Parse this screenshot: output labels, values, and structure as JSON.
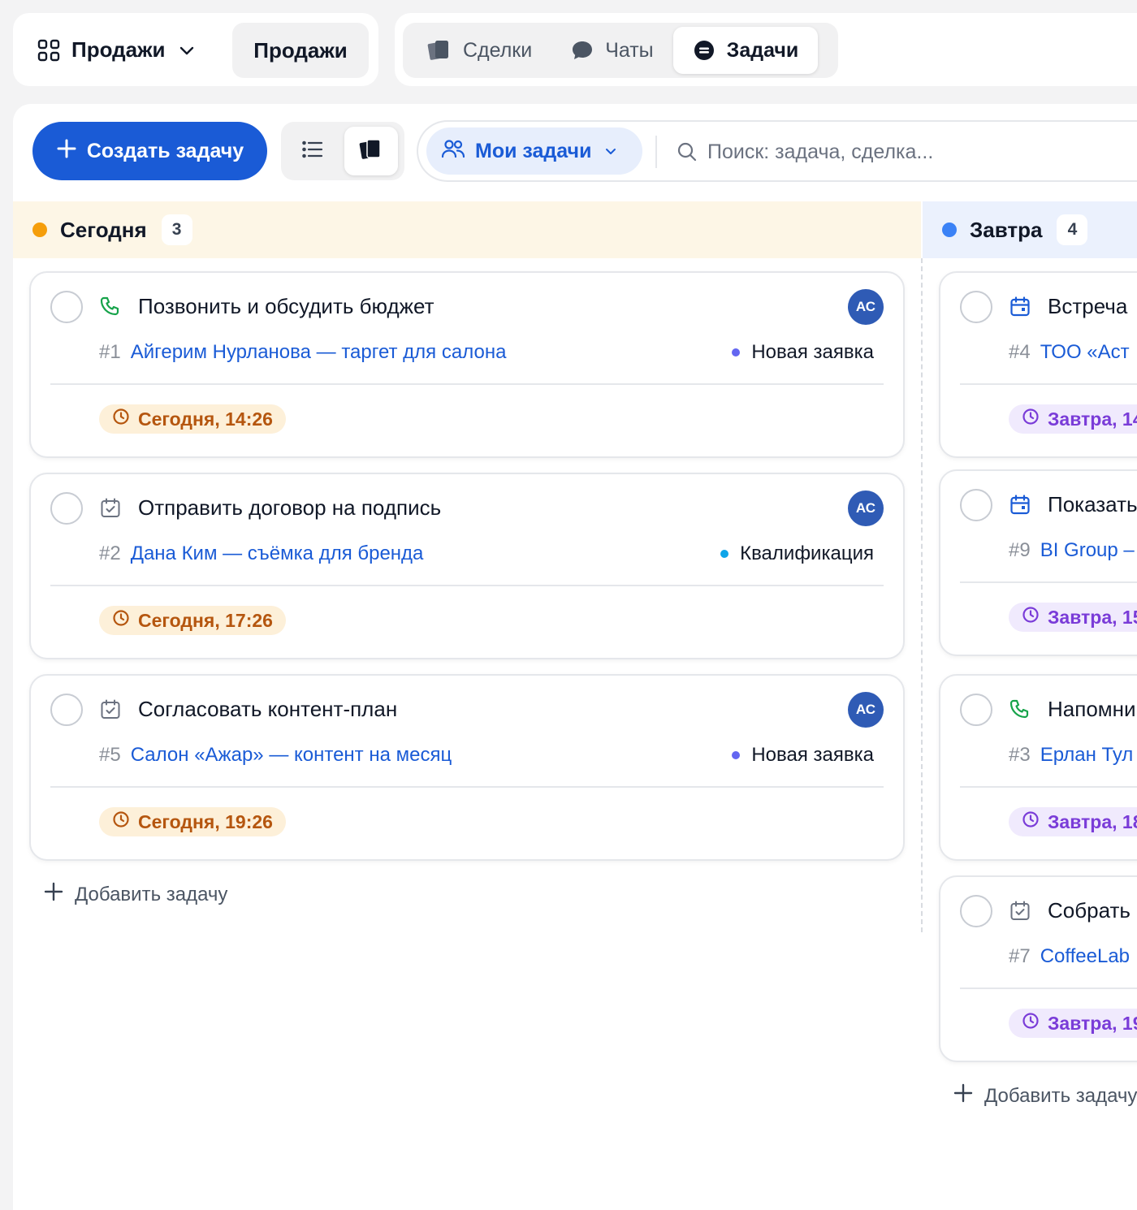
{
  "workspace": {
    "selector_label": "Продажи",
    "chip_label": "Продажи"
  },
  "nav_tabs": [
    {
      "label": "Сделки",
      "active": false
    },
    {
      "label": "Чаты",
      "active": false
    },
    {
      "label": "Задачи",
      "active": true
    }
  ],
  "toolbar": {
    "create_label": "Создать задачу",
    "filter_label": "Мои задачи",
    "search_placeholder": "Поиск: задача, сделка..."
  },
  "columns": {
    "today": {
      "title": "Сегодня",
      "count": "3",
      "add_label": "Добавить задачу",
      "cards": [
        {
          "icon": "phone-icon",
          "title": "Позвонить и обсудить бюджет",
          "num": "#1",
          "deal": "Айгерим Нурланова — таргет для салона",
          "stage": "Новая заявка",
          "due": "Сегодня, 14:26",
          "avatar": "АС"
        },
        {
          "icon": "calendar-check-icon",
          "title": "Отправить договор на подпись",
          "num": "#2",
          "deal": "Дана Ким — съёмка для бренда",
          "stage": "Квалификация",
          "due": "Сегодня, 17:26",
          "avatar": "АС"
        },
        {
          "icon": "calendar-check-icon",
          "title": "Согласовать контент-план",
          "num": "#5",
          "deal": "Салон «Ажар» — контент на месяц",
          "stage": "Новая заявка",
          "due": "Сегодня, 19:26",
          "avatar": "АС"
        }
      ]
    },
    "tomorrow": {
      "title": "Завтра",
      "count": "4",
      "add_label": "Добавить задачу",
      "cards": [
        {
          "icon": "calendar-icon",
          "title": "Встреча",
          "num": "#4",
          "deal": "ТОО «Аст",
          "due": "Завтра, 14"
        },
        {
          "icon": "calendar-icon",
          "title": "Показать",
          "num": "#9",
          "deal": "BI Group –",
          "due": "Завтра, 15"
        },
        {
          "icon": "phone-icon",
          "title": "Напомни",
          "num": "#3",
          "deal": "Ерлан Тул",
          "due": "Завтра, 18"
        },
        {
          "icon": "calendar-check-icon",
          "title": "Собрать",
          "num": "#7",
          "deal": "CoffeeLab",
          "due": "Завтра, 19"
        }
      ]
    }
  },
  "colors": {
    "accent": "#1a5bd6",
    "today_dot": "#f59e0b",
    "tomorrow_dot": "#3b82f6",
    "stage_new": "#6366f1",
    "stage_qual": "#0ea5e9",
    "avatar": "#2f5bb5"
  }
}
